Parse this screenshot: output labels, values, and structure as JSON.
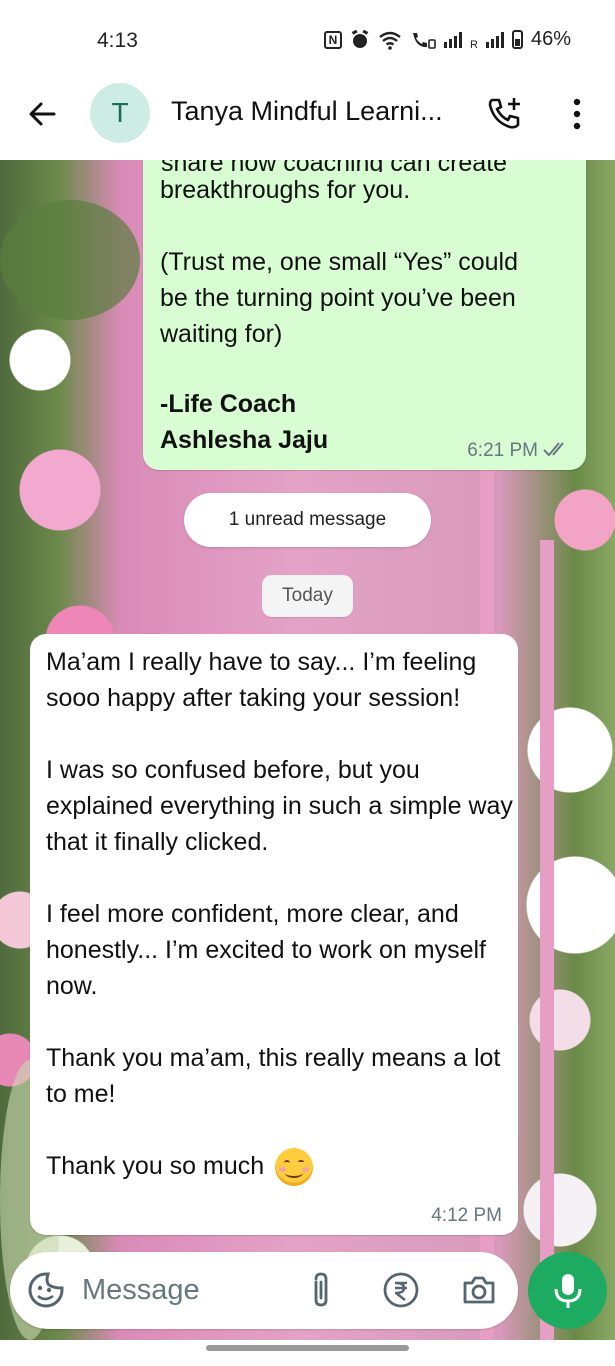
{
  "status_bar": {
    "time": "4:13",
    "network_label": "R",
    "battery": "46%"
  },
  "header": {
    "avatar_letter": "T",
    "contact_name": "Tanya Mindful Learni..."
  },
  "messages": {
    "outgoing": {
      "cut_line": "share how coaching can create",
      "text": "breakthroughs for you.\n\n(Trust me, one small “Yes” could\nbe the turning point you’ve been\nwaiting for)",
      "signature": "-Life Coach\nAshlesha Jaju",
      "time": "6:21 PM"
    },
    "unread_label": "1 unread message",
    "date_label": "Today",
    "incoming": {
      "paragraphs": [
        "Ma’am I really have to say... I’m feeling sooo happy after taking your session!",
        "I was so confused before, but you explained everything in such a simple way that it finally clicked.",
        "I feel more confident, more clear, and honestly... I’m excited to work on myself now.",
        "Thank you ma’am, this really means a lot to me!",
        "Thank you so much"
      ],
      "time": "4:12 PM"
    }
  },
  "input_bar": {
    "placeholder": "Message"
  },
  "colors": {
    "outgoing_bubble": "#d9fdd3",
    "mic_button": "#1daa61",
    "avatar_bg": "#cdece4",
    "timestamp": "#667781"
  },
  "icons": {
    "back": "back-arrow-icon",
    "call": "add-call-icon",
    "more": "more-vert-icon",
    "sticker": "sticker-icon",
    "attach": "attach-icon",
    "payment": "rupee-icon",
    "camera": "camera-icon",
    "mic": "mic-icon",
    "read": "double-check-icon"
  }
}
